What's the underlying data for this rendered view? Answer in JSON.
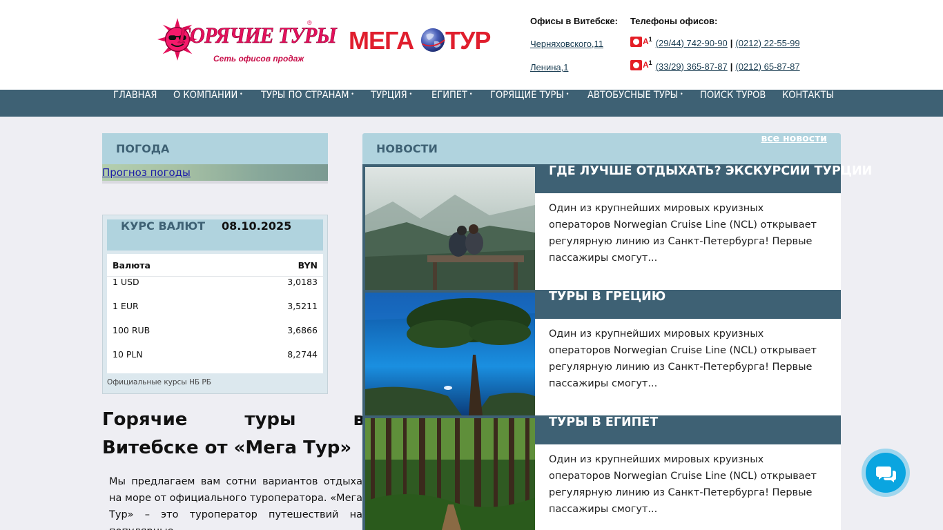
{
  "header": {
    "logo1": {
      "title": "ГОРЯЧИЕ ТУРЫ",
      "reg": "®",
      "subtitle": "Сеть офисов продаж"
    },
    "logo2": {
      "part1": "МЕГА",
      "part2": "ТУР"
    },
    "offices_label": "Офисы в Витебске:",
    "offices": [
      "Черняховского,11",
      "Ленина,1"
    ],
    "phones_label": "Телефоны офисов:",
    "phone_rows": [
      {
        "operator_icon": "a1-operator-icon",
        "mobile": "(29/44) 742-90-90",
        "separator": "|",
        "city": "(0212) 22-55-99"
      },
      {
        "operator_icon": "a1-operator-icon",
        "mobile": "(33/29) 365-87-87",
        "separator": "|",
        "city": "(0212) 65-87-87"
      }
    ],
    "a1_text": "A",
    "a1_sup": "1"
  },
  "nav": {
    "items": [
      {
        "label": "ГЛАВНАЯ",
        "has_dropdown": false
      },
      {
        "label": "О КОМПАНИИ",
        "has_dropdown": true
      },
      {
        "label": "ТУРЫ ПО СТРАНАМ",
        "has_dropdown": true
      },
      {
        "label": "ТУРЦИЯ",
        "has_dropdown": true
      },
      {
        "label": "ЕГИПЕТ",
        "has_dropdown": true
      },
      {
        "label": "ГОРЯЩИЕ ТУРЫ",
        "has_dropdown": true
      },
      {
        "label": "АВТОБУСНЫЕ ТУРЫ",
        "has_dropdown": true
      },
      {
        "label": "ПОИСК ТУРОВ",
        "has_dropdown": false
      },
      {
        "label": "КОНТАКТЫ",
        "has_dropdown": false
      }
    ],
    "dropdown_marker": "•"
  },
  "weather": {
    "title": "ПОГОДА",
    "link": "Прогноз погоды"
  },
  "currency": {
    "title": "КУРС ВАЛЮТ",
    "date": "08.10.2025",
    "col_currency": "Валюта",
    "col_base": "BYN",
    "rows": [
      {
        "name": "1 USD",
        "value": "3,0183"
      },
      {
        "name": "1 EUR",
        "value": "3,5211"
      },
      {
        "name": "100 RUB",
        "value": "3,6866"
      },
      {
        "name": "10 PLN",
        "value": "8,2744"
      }
    ],
    "note": "Официальные курсы НБ РБ"
  },
  "intro": {
    "title": "Горячие туры в Витебске от «Мега Тур»",
    "text": "Мы предлагаем вам сотни вариантов отдыха на море от официального туроператора. «Мега Тур» – это туроператор путешествий на популярные"
  },
  "news": {
    "title": "НОВОСТИ",
    "all_link": "все новости",
    "items": [
      {
        "title": "ГДЕ ЛУЧШЕ ОТДЫХАТЬ? ЭКСКУРСИИ ТУРЦИИ",
        "text": "Один из крупнейших мировых круизных операторов Norwegian Cruise Line (NCL) открывает регулярную линию из Санкт-Петербурга! Первые пассажиры смогут..."
      },
      {
        "title": "ТУРЫ В ГРЕЦИЮ",
        "text": "Один из крупнейших мировых круизных операторов Norwegian Cruise Line (NCL) открывает регулярную линию из Санкт-Петербурга! Первые пассажиры смогут..."
      },
      {
        "title": "ТУРЫ В ЕГИПЕТ",
        "text": "Один из крупнейших мировых круизных операторов Norwegian Cruise Line (NCL) открывает регулярную линию из Санкт-Петербурга! Первые пассажиры смогут..."
      }
    ]
  },
  "colors": {
    "nav_bg": "#3e6174",
    "panel_head_bg": "#b0d3de",
    "brand_red": "#e4105b",
    "chat": "#0aa5e0"
  }
}
